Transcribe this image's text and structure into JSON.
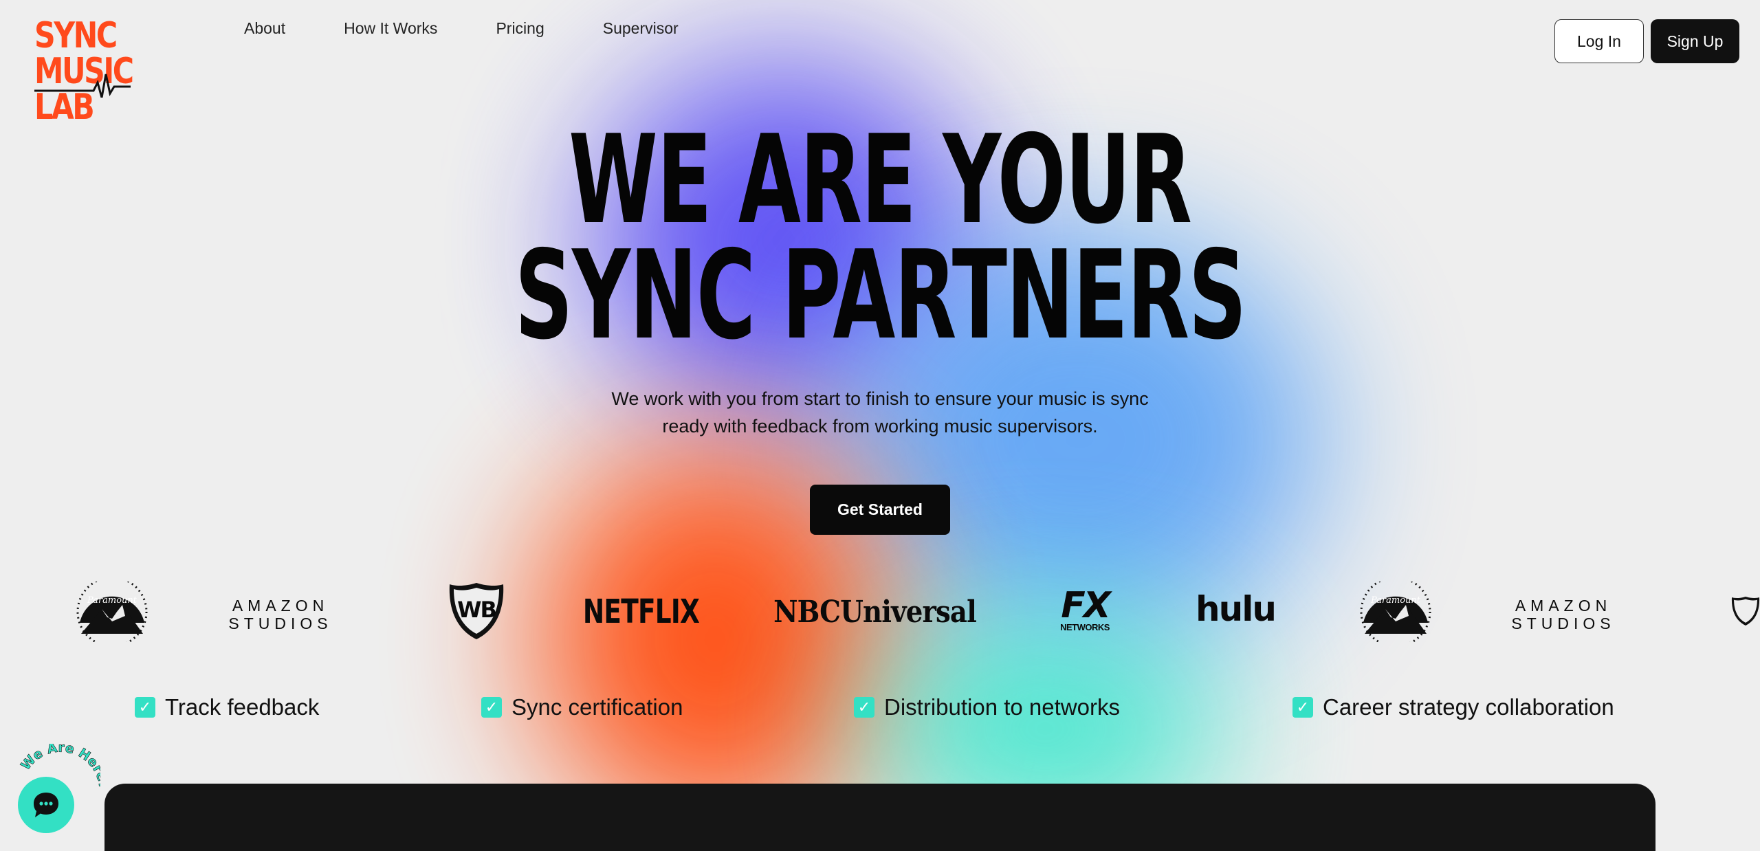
{
  "brand": {
    "logo_lines": [
      "SYNC",
      "MUSIC",
      "LAB"
    ]
  },
  "nav": {
    "items": [
      "About",
      "How It Works",
      "Pricing",
      "Supervisor"
    ]
  },
  "auth": {
    "login_label": "Log In",
    "signup_label": "Sign Up"
  },
  "hero": {
    "title_line1": "WE ARE YOUR",
    "title_line2": "SYNC PARTNERS",
    "subtitle": "We work with you from start to finish to ensure your music is sync ready with feedback from working music supervisors.",
    "cta_label": "Get Started"
  },
  "partners": {
    "paramount": "Paramount",
    "amazon_line1": "AMAZON",
    "amazon_line2": "STUDIOS",
    "wb": "WB",
    "netflix": "NETFLIX",
    "nbcuniversal": "NBCUniversal",
    "fx": "FX",
    "fx_sub": "NETWORKS",
    "hulu": "hulu"
  },
  "features": [
    "Track feedback",
    "Sync certification",
    "Distribution to networks",
    "Career strategy collaboration"
  ],
  "chat": {
    "badge_text": "We Are Here!"
  },
  "colors": {
    "accent_orange": "#ff4a1c",
    "accent_teal": "#33e0c4",
    "blob_purple": "#5a4df5",
    "blob_blue": "#5aa2f6",
    "dark": "#111111"
  }
}
